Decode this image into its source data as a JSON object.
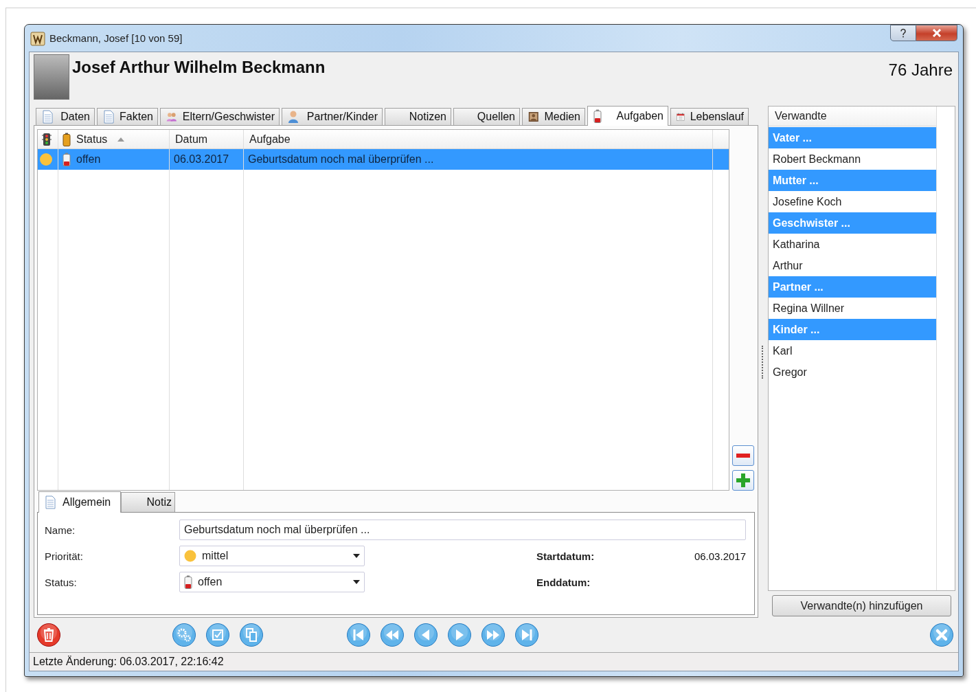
{
  "window": {
    "title": "Beckmann, Josef [10 von 59]"
  },
  "header": {
    "name": "Josef Arthur Wilhelm Beckmann",
    "age": "76 Jahre"
  },
  "tabs": [
    {
      "label": "Daten",
      "selected": false
    },
    {
      "label": "Fakten",
      "selected": false
    },
    {
      "label": "Eltern/Geschwister",
      "selected": false
    },
    {
      "label": "Partner/Kinder",
      "selected": false
    },
    {
      "label": "Notizen",
      "selected": false
    },
    {
      "label": "Quellen",
      "selected": false
    },
    {
      "label": "Medien",
      "selected": false
    },
    {
      "label": "Aufgaben",
      "selected": true
    },
    {
      "label": "Lebenslauf",
      "selected": false
    }
  ],
  "tasks": {
    "columns": [
      {
        "label": "Status",
        "sorted": true
      },
      {
        "label": "Datum",
        "sorted": false
      },
      {
        "label": "Aufgabe",
        "sorted": false
      }
    ],
    "rows": [
      {
        "color": "#f9c23c",
        "status": "offen",
        "date": "06.03.2017",
        "task": "Geburtsdatum noch mal überprüfen ...",
        "selected": true
      }
    ]
  },
  "detail_tabs": [
    {
      "label": "Allgemein",
      "selected": true
    },
    {
      "label": "Notiz",
      "selected": false
    }
  ],
  "form": {
    "name": {
      "label": "Name:",
      "value": "Geburtsdatum noch mal überprüfen ..."
    },
    "priority": {
      "label": "Priorität:",
      "value": "mittel",
      "color": "#f9c23c"
    },
    "status": {
      "label": "Status:",
      "value": "offen"
    },
    "start": {
      "label": "Startdatum:",
      "value": "06.03.2017"
    },
    "end": {
      "label": "Enddatum:"
    }
  },
  "relatives": {
    "title": "Verwandte",
    "items": [
      {
        "kind": "group",
        "label": "Vater ..."
      },
      {
        "kind": "person",
        "label": "Robert Beckmann"
      },
      {
        "kind": "group",
        "label": "Mutter ..."
      },
      {
        "kind": "person",
        "label": "Josefine Koch"
      },
      {
        "kind": "group",
        "label": "Geschwister ..."
      },
      {
        "kind": "person",
        "label": "Katharina"
      },
      {
        "kind": "person",
        "label": "Arthur"
      },
      {
        "kind": "group",
        "label": "Partner ..."
      },
      {
        "kind": "person",
        "label": "Regina Willner"
      },
      {
        "kind": "group",
        "label": "Kinder ..."
      },
      {
        "kind": "person",
        "label": "Karl"
      },
      {
        "kind": "person",
        "label": "Gregor"
      }
    ],
    "add_button": "Verwandte(n) hinzufügen"
  },
  "status_bar": "Letzte Änderung: 06.03.2017, 22:16:42"
}
